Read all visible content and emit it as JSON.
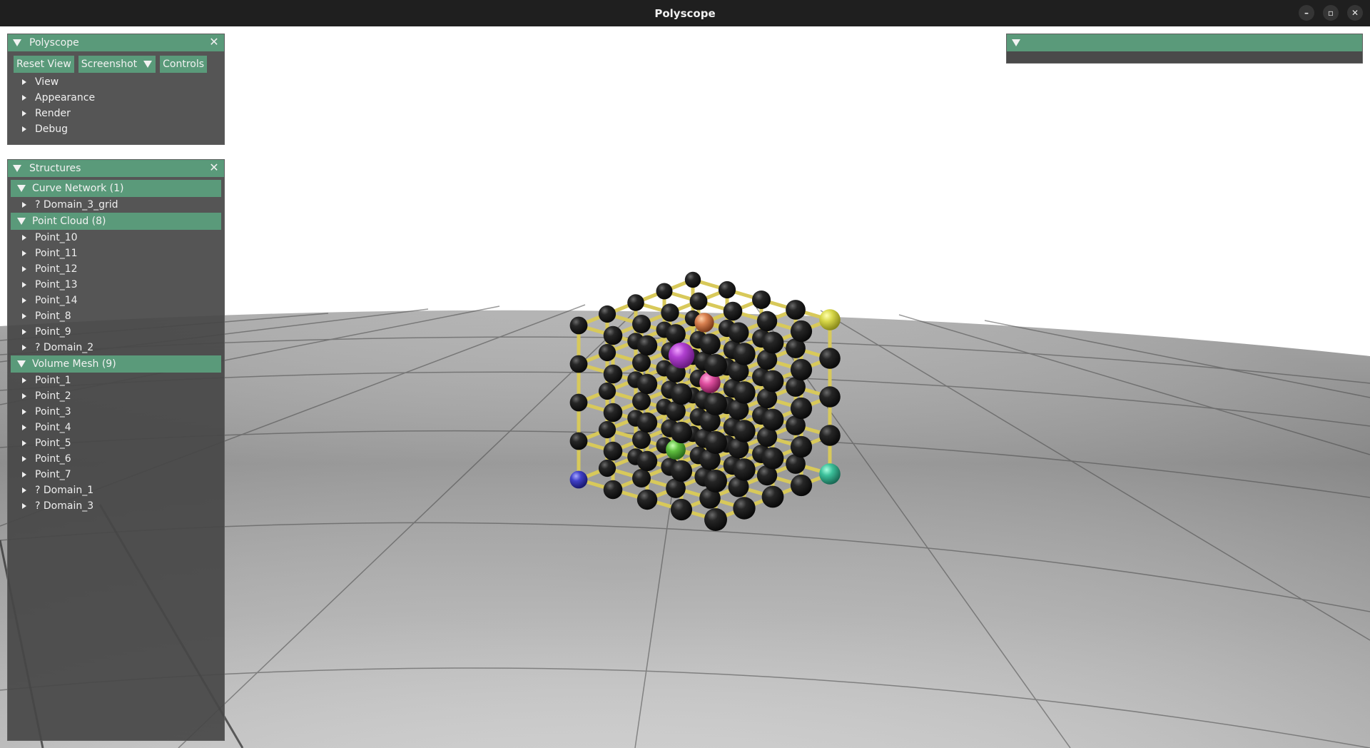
{
  "window": {
    "title": "Polyscope",
    "controls": {
      "minimize": "–",
      "maximize": "▫",
      "close": "✕"
    }
  },
  "polyscope_panel": {
    "title": "Polyscope",
    "buttons": {
      "reset_view": "Reset View",
      "screenshot": "Screenshot",
      "controls": "Controls"
    },
    "menu": [
      "View",
      "Appearance",
      "Render",
      "Debug"
    ]
  },
  "structures_panel": {
    "title": "Structures",
    "groups": [
      {
        "label": "Curve Network (1)",
        "items": [
          "? Domain_3_grid"
        ]
      },
      {
        "label": "Point Cloud (8)",
        "items": [
          "Point_10",
          "Point_11",
          "Point_12",
          "Point_13",
          "Point_14",
          "Point_8",
          "Point_9",
          "? Domain_2"
        ]
      },
      {
        "label": "Volume Mesh (9)",
        "items": [
          "Point_1",
          "Point_2",
          "Point_3",
          "Point_4",
          "Point_5",
          "Point_6",
          "Point_7",
          "? Domain_1",
          "? Domain_3"
        ]
      }
    ]
  },
  "icons": {
    "collapse": "triangle-down-icon",
    "expand": "triangle-right-icon",
    "close": "close-icon"
  },
  "colors": {
    "accent": "#5a9a7a",
    "panel_bg": "#464646",
    "titlebar": "#1f1f1f",
    "grid_edge": "#d6c452",
    "node": "#1a1a1a"
  }
}
